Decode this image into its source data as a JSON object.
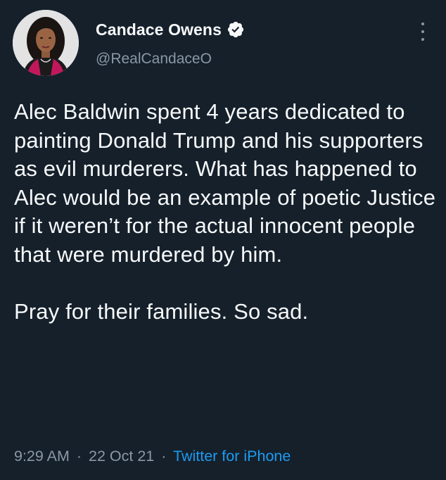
{
  "user": {
    "display_name": "Candace Owens",
    "handle": "@RealCandaceO",
    "verified": true,
    "avatar_icon": "profile-photo"
  },
  "tweet": {
    "text_paragraph_1": "Alec Baldwin spent 4 years dedicated to painting Donald Trump and his supporters as evil murderers. What has happened to Alec would be an example of poetic Justice if it weren’t for the actual innocent people that were murdered by him.",
    "text_paragraph_2": "Pray for their families. So sad.",
    "time": "9:29 AM",
    "date": "22 Oct 21",
    "separator": "·",
    "source": "Twitter for iPhone"
  },
  "icons": {
    "verified": "verified-badge-icon",
    "more": "more-options-icon"
  },
  "colors": {
    "background": "#15202b",
    "primary_text": "#f7f9f9",
    "secondary_text": "#8b98a5",
    "link": "#1d9bf0"
  }
}
